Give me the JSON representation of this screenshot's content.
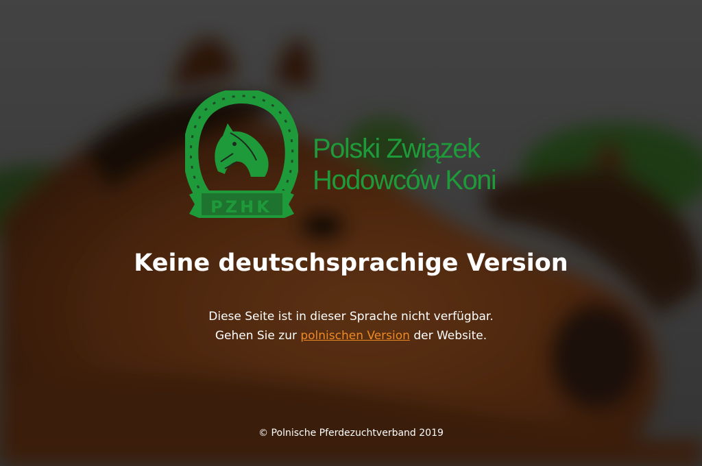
{
  "page": {
    "title": "Keine deutschsprachige Version",
    "message_line1": "Diese Seite ist in dieser Sprache nicht verfügbar.",
    "message_line2_before": "Gehen Sie zur",
    "message_link": "polnischen Version",
    "message_line2_after": "der Website.",
    "footer": "© Polnische Pferdezuchtverband 2019"
  },
  "logo": {
    "org_name_line1": "Polski Związek",
    "org_name_line2": "Hodowców Koni",
    "badge_text": "PZHK",
    "color": "#1f9a3a"
  },
  "colors": {
    "link": "#f08a24",
    "text": "#ffffff",
    "overlay": "rgba(0,0,0,0.52)"
  },
  "background": {
    "icon": "horse-photo"
  }
}
